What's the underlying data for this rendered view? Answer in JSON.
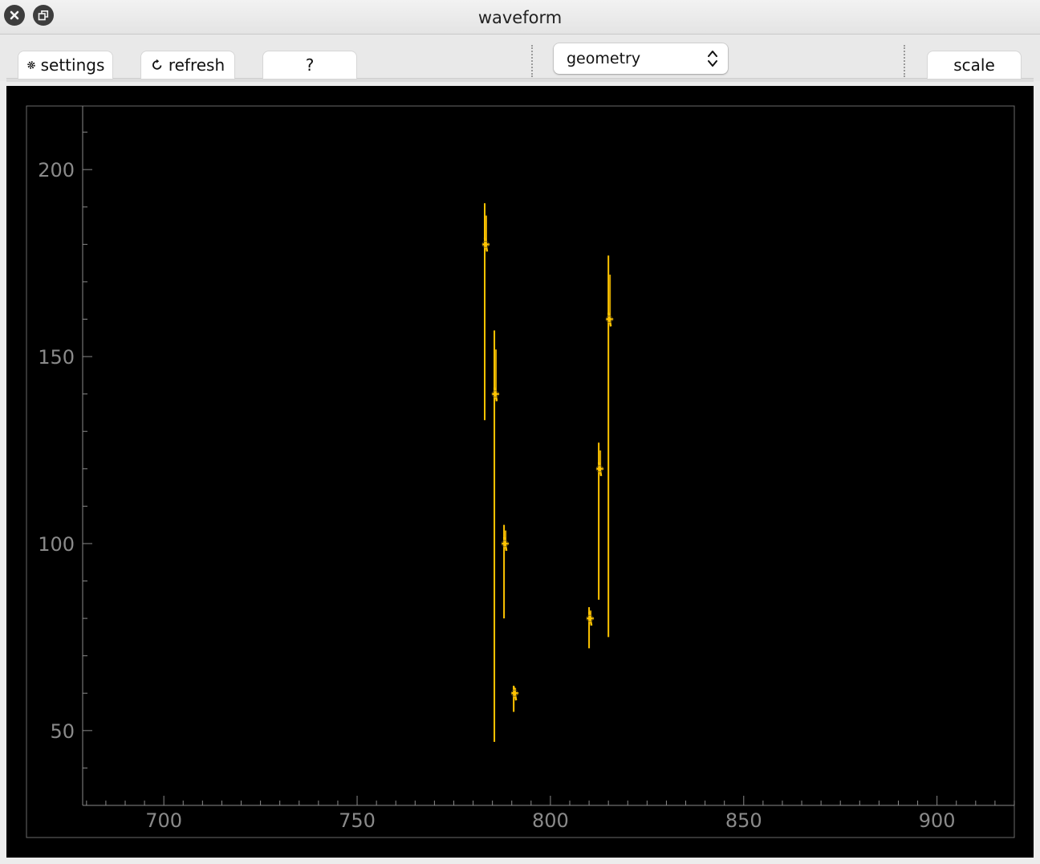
{
  "window": {
    "title": "waveform"
  },
  "toolbar": {
    "settings_label": "settings",
    "refresh_label": "refresh",
    "help_label": "?",
    "view_select": {
      "value": "geometry"
    },
    "scale_label": "scale"
  },
  "colors": {
    "trace": "#ffc400",
    "background": "#000000",
    "axis": "#8a8a8a"
  },
  "chart_data": {
    "type": "scatter",
    "title": "",
    "xlabel": "",
    "ylabel": "",
    "xlim": [
      679,
      920
    ],
    "ylim": [
      30,
      217
    ],
    "xticks": [
      700,
      750,
      800,
      850,
      900
    ],
    "yticks": [
      50,
      100,
      150,
      200
    ],
    "grid": false,
    "points": [
      {
        "x": 783,
        "y": 180,
        "low": 133,
        "high": 191
      },
      {
        "x": 785.5,
        "y": 140,
        "low": 47,
        "high": 157
      },
      {
        "x": 788,
        "y": 100,
        "low": 80,
        "high": 105
      },
      {
        "x": 790.5,
        "y": 60,
        "low": 55,
        "high": 62
      },
      {
        "x": 810,
        "y": 80,
        "low": 72,
        "high": 83
      },
      {
        "x": 812.5,
        "y": 120,
        "low": 85,
        "high": 127
      },
      {
        "x": 815,
        "y": 160,
        "low": 75,
        "high": 177
      }
    ]
  }
}
